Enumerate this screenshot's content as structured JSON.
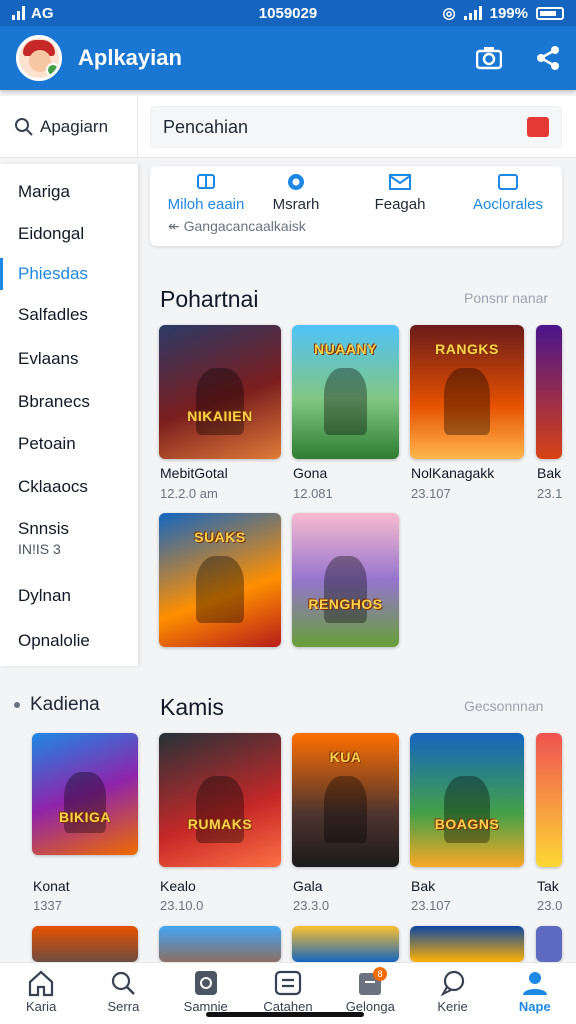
{
  "status": {
    "carrier": "AG",
    "time": "1059029",
    "battery": "199%"
  },
  "header": {
    "title": "Aplkayian",
    "camera_icon": "camera-icon",
    "share_icon": "share-icon",
    "accent": "#1976d2"
  },
  "search": {
    "left_label": "Apagiarn",
    "placeholder": "Pencahian"
  },
  "sidebar": {
    "items": [
      {
        "label": "Mariga"
      },
      {
        "label": "Eidongal"
      },
      {
        "label": "Phiesdas",
        "active": true
      },
      {
        "label": "Salfadles"
      },
      {
        "label": "Evlaans"
      },
      {
        "label": "Bbranecs"
      },
      {
        "label": "Petoain"
      },
      {
        "label": "Cklaaocs"
      },
      {
        "label": "Snnsis",
        "sub": "IN!IS 3"
      },
      {
        "label": "Dylnan"
      },
      {
        "label": "Opnalolie"
      }
    ],
    "kategori": "Kadiena"
  },
  "quick_actions": {
    "items": [
      {
        "label": "Miloh eaain",
        "icon": "book-icon"
      },
      {
        "label": "Msrarh",
        "icon": "location-icon"
      },
      {
        "label": "Feagah",
        "icon": "mail-icon"
      },
      {
        "label": "Aoclorales",
        "icon": "window-icon"
      }
    ],
    "hint": "Gangacancaalkaisk"
  },
  "section1": {
    "title": "Pohartnai",
    "more": "Ponsnr nanar",
    "games": [
      {
        "name": "MebitGotal",
        "meta": "12.2.0 am",
        "logo": "NIKAIIEN"
      },
      {
        "name": "Gona",
        "meta": "12.081",
        "logo": "NUAANY"
      },
      {
        "name": "NolKanagakk",
        "meta": "23.107",
        "logo": "RANGKS"
      },
      {
        "name": "Bak",
        "meta": "23.1"
      },
      {
        "name": "",
        "meta": "",
        "logo": "SUAKS"
      },
      {
        "name": "",
        "meta": "",
        "logo": "RENGHOS"
      }
    ]
  },
  "section2": {
    "title": "Kamis",
    "more": "Gecsonnnan",
    "games": [
      {
        "name": "Konat",
        "meta": "1337",
        "logo": "BIKIGA"
      },
      {
        "name": "Kealo",
        "meta": "23.10.0",
        "logo": "RUMAKS"
      },
      {
        "name": "Gala",
        "meta": "23.3.0",
        "logo": "KUA"
      },
      {
        "name": "Bak",
        "meta": "23.107",
        "logo": "BOAGNS"
      },
      {
        "name": "Tak",
        "meta": "23.0"
      }
    ]
  },
  "bottom_nav": [
    {
      "label": "Karia",
      "icon": "home-icon"
    },
    {
      "label": "Serra",
      "icon": "search-icon"
    },
    {
      "label": "Samnie",
      "icon": "app-icon"
    },
    {
      "label": "Catahen",
      "icon": "grid-icon"
    },
    {
      "label": "Gelonga",
      "icon": "tag-icon",
      "badge": "8"
    },
    {
      "label": "Kerie",
      "icon": "chat-icon"
    },
    {
      "label": "Nape",
      "icon": "person-icon",
      "active": true
    }
  ]
}
